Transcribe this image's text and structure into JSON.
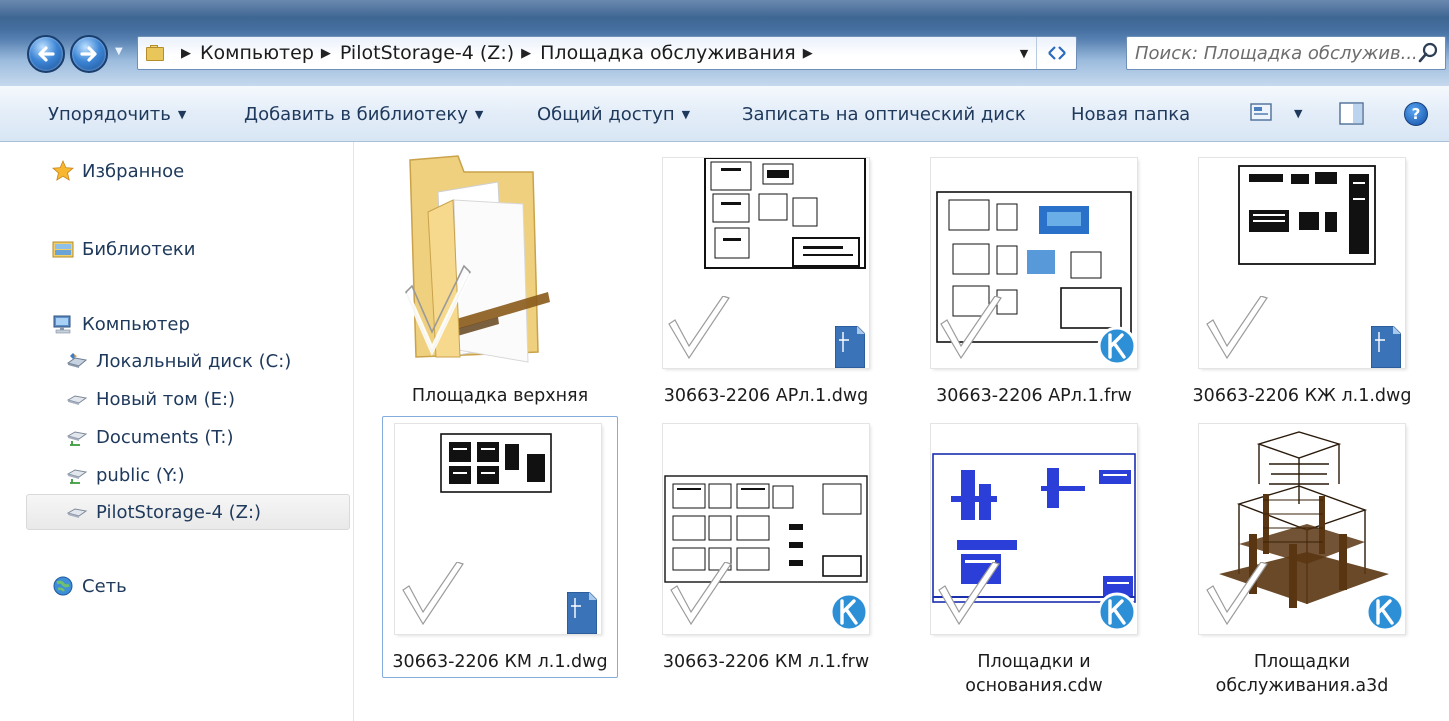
{
  "address_bar": {
    "crumbs": [
      "Компьютер",
      "PilotStorage-4 (Z:)",
      "Площадка обслуживания"
    ],
    "search_placeholder": "Поиск: Площадка обслужив..."
  },
  "toolbar": {
    "organize": "Упорядочить",
    "add_to_library": "Добавить в библиотеку",
    "share": "Общий доступ",
    "burn": "Записать на оптический диск",
    "new_folder": "Новая папка",
    "help": "?"
  },
  "nav": {
    "favorites": "Избранное",
    "libraries": "Библиотеки",
    "computer": "Компьютер",
    "drives": [
      {
        "label": "Локальный диск (C:)",
        "icon": "local-disk-icon"
      },
      {
        "label": "Новый том (E:)",
        "icon": "drive-icon"
      },
      {
        "label": "Documents (T:)",
        "icon": "network-drive-icon"
      },
      {
        "label": "public (Y:)",
        "icon": "network-drive-icon"
      },
      {
        "label": "PilotStorage-4 (Z:)",
        "icon": "drive-icon",
        "selected": true
      }
    ],
    "network": "Сеть"
  },
  "files": [
    {
      "name": "Площадка верхняя",
      "type": "folder"
    },
    {
      "name": "30663-2206 АРл.1.dwg",
      "type": "dwg"
    },
    {
      "name": "30663-2206 АРл.1.frw",
      "type": "kompas"
    },
    {
      "name": "30663-2206 КЖ л.1.dwg",
      "type": "dwg"
    },
    {
      "name": "30663-2206 КМ л.1.dwg",
      "type": "dwg",
      "selected": true
    },
    {
      "name": "30663-2206 КМ л.1.frw",
      "type": "kompas"
    },
    {
      "name_line1": "Площадки и",
      "name_line2": "основания.cdw",
      "type": "kompas"
    },
    {
      "name_line1": "Площадки",
      "name_line2": "обслуживания.a3d",
      "type": "kompas"
    }
  ],
  "colors": {
    "accent": "#1e395b",
    "kompas_badge": "#2d8fd6",
    "selection_border": "#84acdd"
  }
}
